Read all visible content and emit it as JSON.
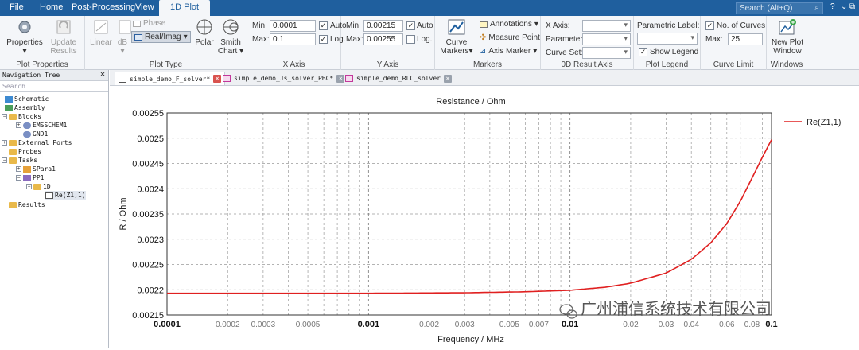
{
  "menu": {
    "items": [
      "File",
      "Home",
      "Post-Processing",
      "View",
      "1D Plot"
    ],
    "active": "1D Plot",
    "search_placeholder": "Search (Alt+Q)"
  },
  "ribbon": {
    "plot_properties": {
      "label": "Plot Properties",
      "properties_btn": "Properties",
      "update_results_btn": "Update Results"
    },
    "plot_type": {
      "label": "Plot Type",
      "linear": "Linear",
      "db": "dB",
      "phase": "Phase",
      "real_imag": "Real/Imag",
      "polar": "Polar",
      "smith_chart": "Smith Chart"
    },
    "x_axis": {
      "label": "X Axis",
      "min_label": "Min:",
      "min_value": "0.0001",
      "max_label": "Max:",
      "max_value": "0.1",
      "auto": "Auto",
      "log": "Log."
    },
    "y_axis": {
      "label": "Y Axis",
      "min_label": "Min:",
      "min_value": "0.00215",
      "max_label": "Max:",
      "max_value": "0.00255",
      "auto": "Auto",
      "log": "Log."
    },
    "markers": {
      "label": "Markers",
      "curve_markers": "Curve Markers",
      "annotations": "Annotations",
      "measure_point": "Measure Point",
      "axis_marker": "Axis Marker"
    },
    "result_axis": {
      "label": "0D Result Axis",
      "x_axis": "X Axis:",
      "parameter": "Parameter:",
      "curve_set": "Curve Set:"
    },
    "plot_legend": {
      "label": "Plot Legend",
      "parametric_label": "Parametric Label:",
      "show_legend": "Show Legend"
    },
    "curve_limit": {
      "label": "Curve Limit",
      "no_of_curves": "No. of Curves",
      "max_label": "Max:",
      "max_value": "25"
    },
    "windows": {
      "label": "Windows",
      "new_plot_window": "New Plot Window"
    }
  },
  "nav": {
    "title": "Navigation Tree",
    "search_placeholder": "Search",
    "nodes": [
      "Schematic",
      "Assembly",
      "Blocks",
      "EMSSCHEM1",
      "GND1",
      "External Ports",
      "Probes",
      "Tasks",
      "SPara1",
      "PP1",
      "1D",
      "Re(Z1,1)",
      "Results"
    ]
  },
  "tabs": [
    {
      "label": "simple_demo_F_solver*"
    },
    {
      "label": "simple_demo_Js_solver_PBC*"
    },
    {
      "label": "simple_demo_RLC_solver"
    }
  ],
  "watermark": "广州浦信系统技术有限公司",
  "colors": {
    "menubar": "#1f5f9e",
    "curve": "#e02020",
    "accent": "#1f5f9e"
  },
  "chart_data": {
    "type": "line",
    "title": "Resistance / Ohm",
    "xlabel": "Frequency / MHz",
    "ylabel": "R / Ohm",
    "xscale": "log",
    "xlim": [
      0.0001,
      0.1
    ],
    "ylim": [
      0.00215,
      0.00255
    ],
    "grid": true,
    "legend_position": "top-right",
    "y_ticks": [
      "0.00255",
      "0.0025",
      "0.00245",
      "0.0024",
      "0.00235",
      "0.0023",
      "0.00225",
      "0.0022",
      "0.00215"
    ],
    "x_ticks_major": [
      {
        "v": 0.0001,
        "label": "0.0001"
      },
      {
        "v": 0.001,
        "label": "0.001"
      },
      {
        "v": 0.01,
        "label": "0.01"
      },
      {
        "v": 0.1,
        "label": "0.1"
      }
    ],
    "x_ticks_minor": [
      {
        "v": 0.0002,
        "label": "0.0002"
      },
      {
        "v": 0.0003,
        "label": "0.0003"
      },
      {
        "v": 0.0005,
        "label": "0.0005"
      },
      {
        "v": 0.002,
        "label": "0.002"
      },
      {
        "v": 0.003,
        "label": "0.003"
      },
      {
        "v": 0.005,
        "label": "0.005"
      },
      {
        "v": 0.007,
        "label": "0.007"
      },
      {
        "v": 0.02,
        "label": "0.02"
      },
      {
        "v": 0.03,
        "label": "0.03"
      },
      {
        "v": 0.04,
        "label": "0.04"
      },
      {
        "v": 0.06,
        "label": "0.06"
      },
      {
        "v": 0.08,
        "label": "0.08"
      }
    ],
    "series": [
      {
        "name": "Re(Z1,1)",
        "color": "#e02020",
        "x": [
          0.0001,
          0.0003,
          0.001,
          0.003,
          0.006,
          0.01,
          0.015,
          0.02,
          0.03,
          0.04,
          0.05,
          0.06,
          0.07,
          0.08,
          0.09,
          0.1
        ],
        "y": [
          0.002193,
          0.002193,
          0.002193,
          0.002194,
          0.002196,
          0.002199,
          0.002205,
          0.002213,
          0.002233,
          0.00226,
          0.002293,
          0.002331,
          0.002375,
          0.002421,
          0.002462,
          0.002497
        ]
      }
    ]
  }
}
